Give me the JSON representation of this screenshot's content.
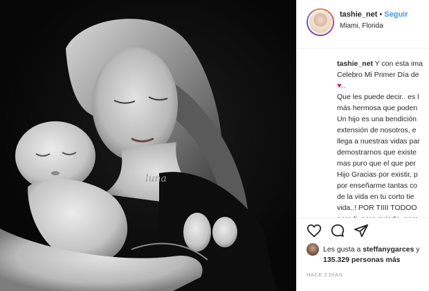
{
  "post": {
    "username": "tashie_net",
    "separator": "•",
    "follow_label": "Seguir",
    "location": "Miami, Florida"
  },
  "caption": {
    "username": "tashie_net",
    "lines": [
      "Y con esta ima",
      "Celebro Mi Primer Día de",
      "♥..",
      "Que les puede decir.. es l",
      "más hermosa que poden",
      "Un hijo es una bendición",
      "extensión de nosotros, e",
      "llega a nuestras vidas par",
      "demostrarnos que existe",
      "mas puro que el que per",
      "Hijo Gracias por existir, p",
      "por enseñarme tantas co",
      "de la vida en tu corto tie",
      "vida..! POR TIIII TODOO",
      "para ti, para guiarte, para"
    ]
  },
  "likes": {
    "prefix": "Les gusta a",
    "user": "steffanygarces",
    "suffix": "y",
    "count": "135.329",
    "count_suffix": "personas más"
  },
  "time": "HACE 2 DÍAS",
  "icons": {
    "like": "heart-icon",
    "comment": "comment-icon",
    "share": "share-icon"
  }
}
